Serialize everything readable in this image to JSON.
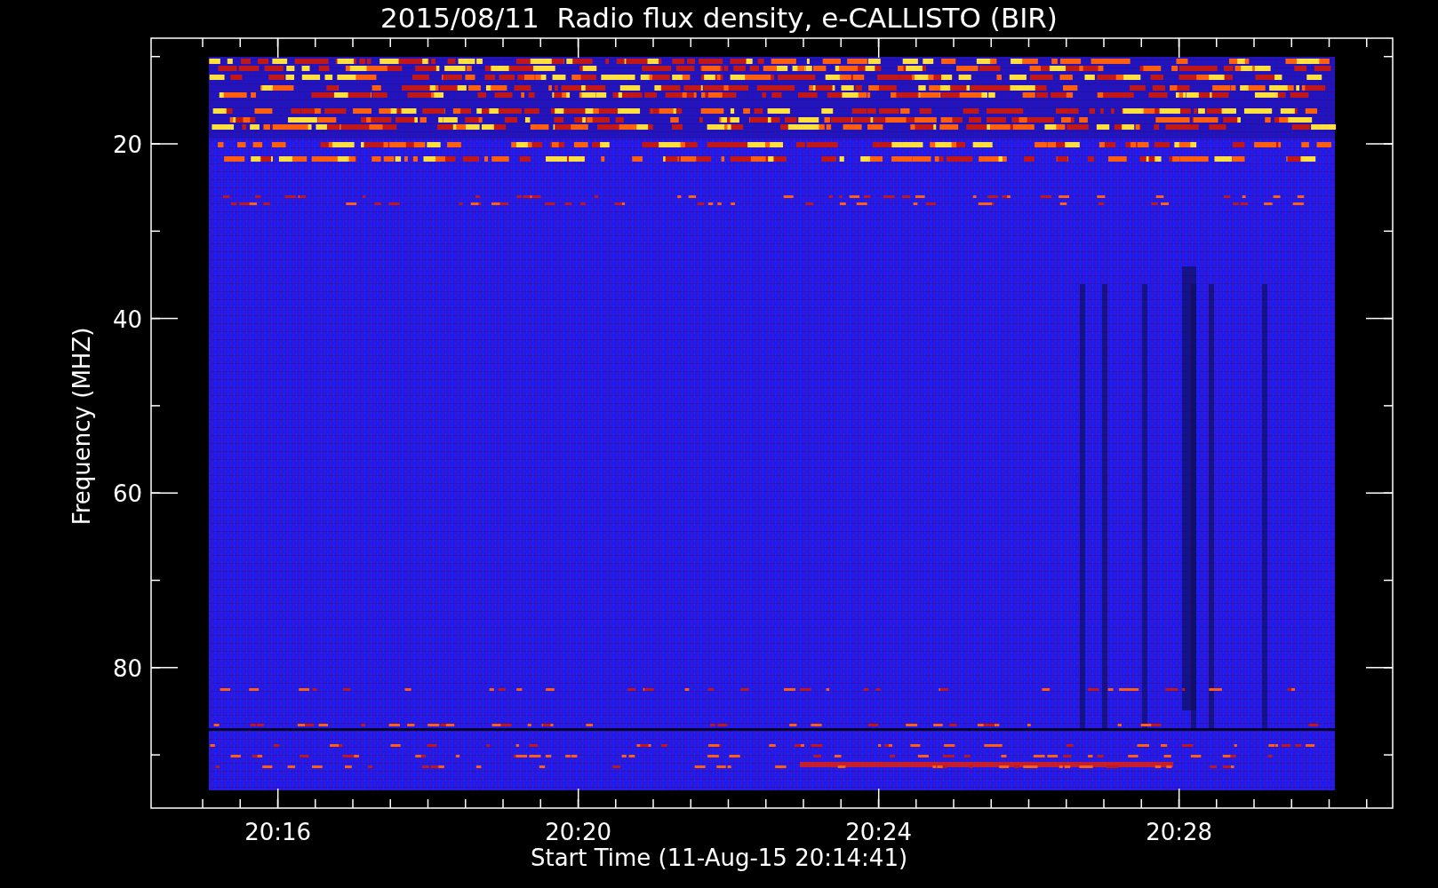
{
  "title": "2015/08/11  Radio flux density, e-CALLISTO (BIR)",
  "y_axis": {
    "label": "Frequency (MHZ)",
    "tick_labels": [
      "20",
      "40",
      "60",
      "80"
    ]
  },
  "x_axis": {
    "label": "Start Time (11-Aug-15 20:14:41)",
    "tick_labels": [
      "20:16",
      "20:20",
      "20:24",
      "20:28"
    ]
  }
}
